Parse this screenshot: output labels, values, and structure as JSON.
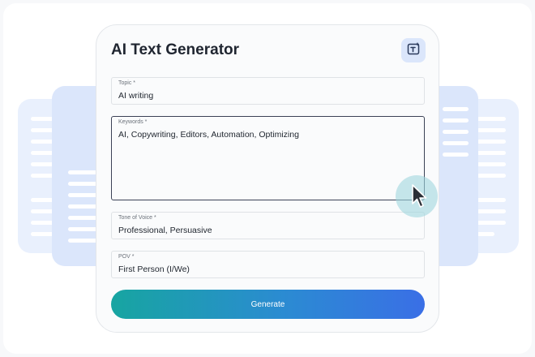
{
  "app": {
    "title": "AI Text Generator",
    "ai_button_icon": "text-ai-icon"
  },
  "form": {
    "topic": {
      "label": "Topic *",
      "value": "AI writing"
    },
    "keywords": {
      "label": "Keywords *",
      "value": "AI, Copywriting, Editors, Automation, Optimizing"
    },
    "tone": {
      "label": "Tone of Voice *",
      "value": "Professional, Persuasive"
    },
    "pov": {
      "label": "POV *",
      "value": "First Person (I/We)"
    },
    "generate_label": "Generate"
  },
  "colors": {
    "accent_start": "#17a5a1",
    "accent_end": "#3a6fe6",
    "card_light": "#e9f0fd",
    "card_mid": "#dbe6fb"
  },
  "cursor_icon": "mouse-pointer-icon"
}
